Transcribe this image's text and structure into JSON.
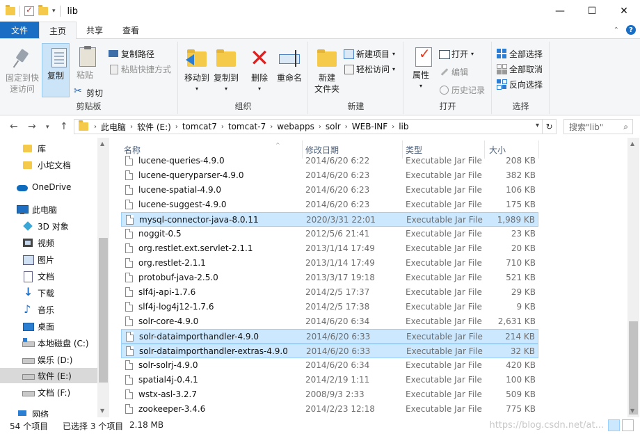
{
  "window": {
    "title": "lib",
    "minimize": "—",
    "maximize": "☐",
    "close": "✕"
  },
  "ribbon_tabs": [
    "文件",
    "主页",
    "共享",
    "查看"
  ],
  "ribbon": {
    "clipboard": {
      "label": "剪贴板",
      "pin_l1": "固定到快",
      "pin_l2": "速访问",
      "copy": "复制",
      "paste": "粘贴",
      "copy_path": "复制路径",
      "paste_shortcut": "粘贴快捷方式",
      "cut": "剪切"
    },
    "organize": {
      "label": "组织",
      "move_to": "移动到",
      "copy_to": "复制到",
      "delete": "删除",
      "rename": "重命名"
    },
    "new": {
      "label": "新建",
      "new_folder_l1": "新建",
      "new_folder_l2": "文件夹",
      "new_item": "新建项目",
      "easy_access": "轻松访问"
    },
    "open": {
      "label": "打开",
      "properties": "属性",
      "open": "打开",
      "edit": "编辑",
      "history": "历史记录"
    },
    "select": {
      "label": "选择",
      "select_all": "全部选择",
      "select_none": "全部取消",
      "invert": "反向选择"
    }
  },
  "address": {
    "crumbs": [
      "此电脑",
      "软件 (E:)",
      "tomcat7",
      "tomcat-7",
      "webapps",
      "solr",
      "WEB-INF",
      "lib"
    ],
    "search_placeholder": "搜索\"lib\""
  },
  "nav_pane": {
    "items": [
      {
        "label": "库",
        "icon": "folder-icon"
      },
      {
        "label": "小坨文档",
        "icon": "folder-icon"
      },
      {
        "label": "OneDrive",
        "icon": "cloud-icon"
      },
      {
        "label": "此电脑",
        "icon": "computer-icon"
      },
      {
        "label": "3D 对象",
        "icon": "cube-icon"
      },
      {
        "label": "视频",
        "icon": "video-icon"
      },
      {
        "label": "图片",
        "icon": "picture-icon"
      },
      {
        "label": "文档",
        "icon": "document-icon"
      },
      {
        "label": "下载",
        "icon": "download-icon"
      },
      {
        "label": "音乐",
        "icon": "music-icon"
      },
      {
        "label": "桌面",
        "icon": "desktop-icon"
      },
      {
        "label": "本地磁盘 (C:)",
        "icon": "drive-icon"
      },
      {
        "label": "娱乐 (D:)",
        "icon": "drive-icon"
      },
      {
        "label": "软件 (E:)",
        "icon": "drive-icon"
      },
      {
        "label": "文档 (F:)",
        "icon": "drive-icon"
      },
      {
        "label": "网络",
        "icon": "network-icon"
      }
    ],
    "selected": "软件 (E:)"
  },
  "columns": {
    "name": "名称",
    "date": "修改日期",
    "type": "类型",
    "size": "大小"
  },
  "files": [
    {
      "name": "lucene-queries-4.9.0",
      "date": "2014/6/20 6:22",
      "type": "Executable Jar File",
      "size": "208 KB",
      "selected": false
    },
    {
      "name": "lucene-queryparser-4.9.0",
      "date": "2014/6/20 6:23",
      "type": "Executable Jar File",
      "size": "382 KB",
      "selected": false
    },
    {
      "name": "lucene-spatial-4.9.0",
      "date": "2014/6/20 6:23",
      "type": "Executable Jar File",
      "size": "106 KB",
      "selected": false
    },
    {
      "name": "lucene-suggest-4.9.0",
      "date": "2014/6/20 6:23",
      "type": "Executable Jar File",
      "size": "175 KB",
      "selected": false
    },
    {
      "name": "mysql-connector-java-8.0.11",
      "date": "2020/3/31 22:01",
      "type": "Executable Jar File",
      "size": "1,989 KB",
      "selected": true
    },
    {
      "name": "noggit-0.5",
      "date": "2012/5/6 21:41",
      "type": "Executable Jar File",
      "size": "23 KB",
      "selected": false
    },
    {
      "name": "org.restlet.ext.servlet-2.1.1",
      "date": "2013/1/14 17:49",
      "type": "Executable Jar File",
      "size": "20 KB",
      "selected": false
    },
    {
      "name": "org.restlet-2.1.1",
      "date": "2013/1/14 17:49",
      "type": "Executable Jar File",
      "size": "710 KB",
      "selected": false
    },
    {
      "name": "protobuf-java-2.5.0",
      "date": "2013/3/17 19:18",
      "type": "Executable Jar File",
      "size": "521 KB",
      "selected": false
    },
    {
      "name": "slf4j-api-1.7.6",
      "date": "2014/2/5 17:37",
      "type": "Executable Jar File",
      "size": "29 KB",
      "selected": false
    },
    {
      "name": "slf4j-log4j12-1.7.6",
      "date": "2014/2/5 17:38",
      "type": "Executable Jar File",
      "size": "9 KB",
      "selected": false
    },
    {
      "name": "solr-core-4.9.0",
      "date": "2014/6/20 6:34",
      "type": "Executable Jar File",
      "size": "2,631 KB",
      "selected": false
    },
    {
      "name": "solr-dataimporthandler-4.9.0",
      "date": "2014/6/20 6:33",
      "type": "Executable Jar File",
      "size": "214 KB",
      "selected": true
    },
    {
      "name": "solr-dataimporthandler-extras-4.9.0",
      "date": "2014/6/20 6:33",
      "type": "Executable Jar File",
      "size": "32 KB",
      "selected": true
    },
    {
      "name": "solr-solrj-4.9.0",
      "date": "2014/6/20 6:34",
      "type": "Executable Jar File",
      "size": "420 KB",
      "selected": false
    },
    {
      "name": "spatial4j-0.4.1",
      "date": "2014/2/19 1:11",
      "type": "Executable Jar File",
      "size": "100 KB",
      "selected": false
    },
    {
      "name": "wstx-asl-3.2.7",
      "date": "2008/9/3 2:33",
      "type": "Executable Jar File",
      "size": "509 KB",
      "selected": false
    },
    {
      "name": "zookeeper-3.4.6",
      "date": "2014/2/23 12:18",
      "type": "Executable Jar File",
      "size": "775 KB",
      "selected": false
    }
  ],
  "status": {
    "count": "54 个项目",
    "selected": "已选择 3 个项目",
    "size": "2.18 MB",
    "watermark": "https://blog.csdn.net/at..."
  }
}
